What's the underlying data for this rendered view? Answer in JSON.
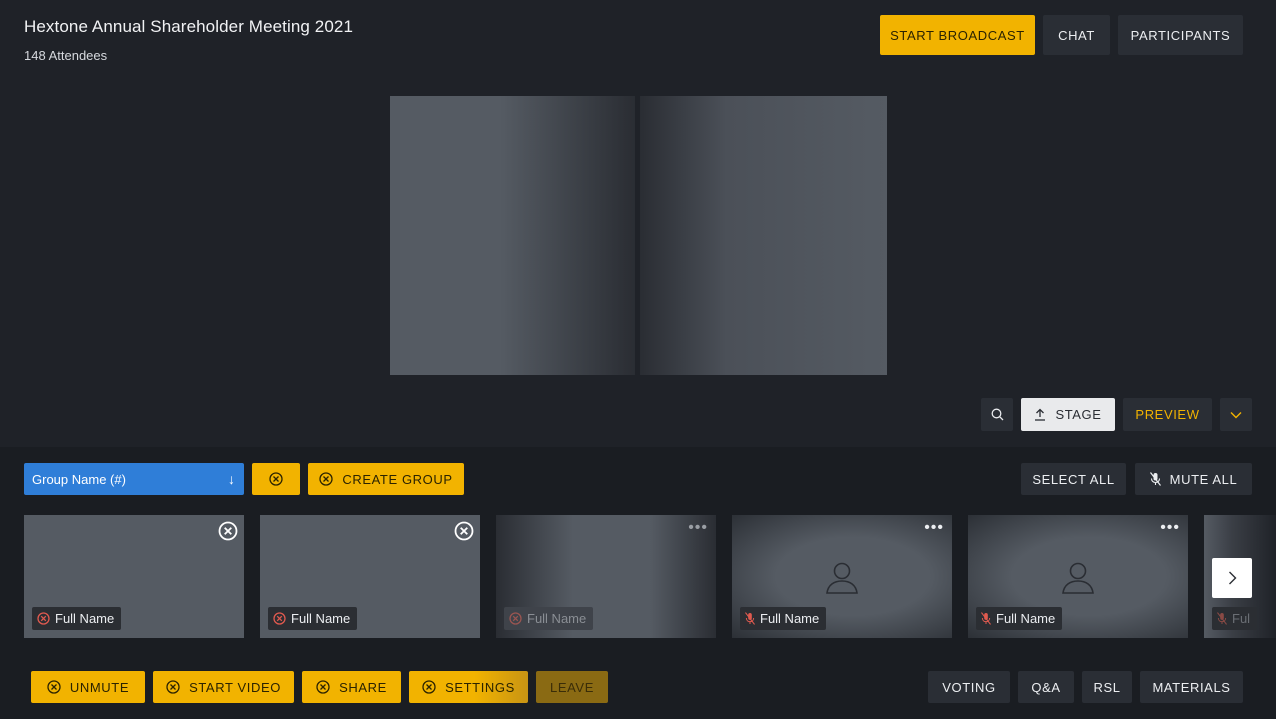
{
  "header": {
    "title": "Hextone Annual Shareholder Meeting 2021",
    "attendees": "148 Attendees",
    "start_broadcast": "START BROADCAST",
    "chat": "CHAT",
    "participants": "PARTICIPANTS"
  },
  "stage_tools": {
    "stage": "STAGE",
    "preview": "PREVIEW"
  },
  "groups": {
    "selected": "Group Name (#)",
    "create_group": "CREATE GROUP",
    "select_all": "SELECT ALL",
    "mute_all": "MUTE ALL"
  },
  "tiles": [
    {
      "name": "Full Name"
    },
    {
      "name": "Full Name"
    },
    {
      "name": "Full Name"
    },
    {
      "name": "Full Name"
    },
    {
      "name": "Full Name"
    },
    {
      "name": "Ful"
    }
  ],
  "controls": {
    "unmute": "UNMUTE",
    "start_video": "START VIDEO",
    "share": "SHARE",
    "settings": "SETTINGS",
    "leave": "LEAVE",
    "voting": "VOTING",
    "qa": "Q&A",
    "rsl": "RSL",
    "materials": "MATERIALS"
  },
  "colors": {
    "accent": "#f2b300",
    "primary_blue": "#2f7ed8",
    "danger": "#e05a4f",
    "background": "#1f2228"
  },
  "icons": [
    "upload-icon",
    "search-icon",
    "chevron-down-icon",
    "close-circle-icon",
    "mic-off-icon",
    "person-icon",
    "more-icon",
    "chevron-right-icon",
    "arrow-down-icon"
  ]
}
